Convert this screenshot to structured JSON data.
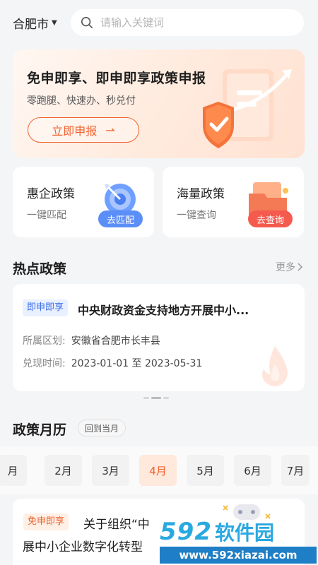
{
  "header": {
    "city": "合肥市",
    "search_placeholder": "请输入关键词"
  },
  "banner": {
    "title": "免申即享、即申即享政策申报",
    "subtitle": "零跑腿、快速办、秒兑付",
    "button_label": "立即申报",
    "button_arrow": "⇀"
  },
  "quick_cards": [
    {
      "title": "惠企政策",
      "subtitle": "一键匹配",
      "button_label": "去匹配",
      "color": "#5b8ef7"
    },
    {
      "title": "海量政策",
      "subtitle": "一键查询",
      "button_label": "去查询",
      "color": "#f55a4e"
    }
  ],
  "hot_policy": {
    "section_title": "热点政策",
    "more_label": "更多",
    "card": {
      "tag": "即申即享",
      "title": "中央财政资金支持地方开展中小...",
      "region_label": "所属区划:",
      "region_value": "安徽省合肥市长丰县",
      "date_label": "兑现时间:",
      "date_value": "2023-01-01 至 2023-05-31"
    }
  },
  "calendar": {
    "section_title": "政策月历",
    "back_label": "回到当月",
    "months": [
      "月",
      "2月",
      "3月",
      "4月",
      "5月",
      "6月",
      "7月"
    ],
    "active_month": "4月",
    "card": {
      "tag": "免申即享",
      "line1": "关于组织“中",
      "line2": "展中小企业数字化转型"
    }
  },
  "watermark": {
    "number": "592",
    "text": "软件园",
    "url": "www.592xiazai.com"
  },
  "colors": {
    "accent": "#f0622d",
    "blue": "#3b6ee8",
    "background": "#f4f5f7"
  }
}
